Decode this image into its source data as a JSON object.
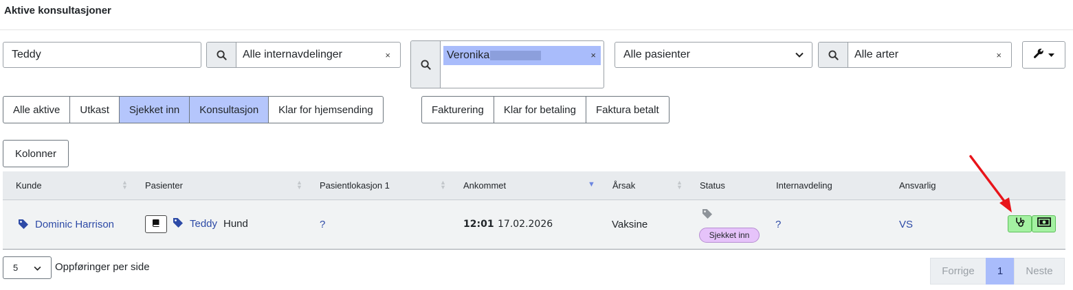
{
  "page": {
    "title": "Aktive konsultasjoner"
  },
  "filters": {
    "patient_search": "Teddy",
    "internal_department": {
      "value": "Alle internavdelinger",
      "clear": "×"
    },
    "responsible": {
      "value": "Veronika",
      "clear": "×"
    },
    "patient_select": {
      "value": "Alle pasienter",
      "chevron": "⌄"
    },
    "species": {
      "value": "Alle arter",
      "clear": "×"
    }
  },
  "status_tabs": [
    {
      "label": "Alle aktive",
      "active": false
    },
    {
      "label": "Utkast",
      "active": false
    },
    {
      "label": "Sjekket inn",
      "active": true
    },
    {
      "label": "Konsultasjon",
      "active": true
    },
    {
      "label": "Klar for hjemsending",
      "active": false
    }
  ],
  "billing_tabs": [
    {
      "label": "Fakturering",
      "active": false
    },
    {
      "label": "Klar for betaling",
      "active": false
    },
    {
      "label": "Faktura betalt",
      "active": false
    }
  ],
  "columns_button": "Kolonner",
  "table": {
    "headers": {
      "customer": "Kunde",
      "patients": "Pasienter",
      "patient_location": "Pasientlokasjon 1",
      "arrived": "Ankommet",
      "reason": "Årsak",
      "status": "Status",
      "internal_department": "Internavdeling",
      "responsible": "Ansvarlig"
    },
    "rows": [
      {
        "customer": "Dominic Harrison",
        "patient_name": "Teddy",
        "patient_species": "Hund",
        "patient_location": "?",
        "arrived_time": "12:01",
        "arrived_date": "17.02.2026",
        "reason": "Vaksine",
        "status": "Sjekket inn",
        "internal_department": "?",
        "responsible": "VS"
      }
    ]
  },
  "pagination": {
    "per_page_value": "5",
    "per_page_label": "Oppføringer per side",
    "prev": "Forrige",
    "current": "1",
    "next": "Neste"
  },
  "colors": {
    "active_tab": "#b5c6fc",
    "link": "#2d4aa6",
    "status_badge": "#e6c3fa",
    "action_button": "#a4f1a2",
    "annotation_arrow": "#e8141a"
  }
}
